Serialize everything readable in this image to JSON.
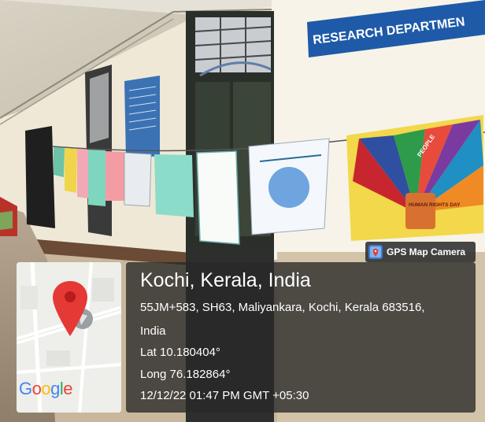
{
  "sign": {
    "text": "RESEARCH DEPARTMEN"
  },
  "badge": {
    "label": "GPS Map Camera",
    "icon": "gps-camera-icon"
  },
  "location": {
    "place": "Kochi, Kerala, India",
    "address_line1": "55JM+583, SH63, Maliyankara, Kochi, Kerala 683516,",
    "address_line2": "India",
    "lat": "Lat 10.180404°",
    "long": "Long 76.182864°",
    "datetime": "12/12/22 01:47 PM GMT +05:30"
  },
  "map": {
    "logo": {
      "G": "G",
      "o1": "o",
      "o2": "o",
      "g": "g",
      "l": "l",
      "e": "e"
    },
    "pin_icon": "map-pin-icon",
    "logo_colors": {
      "G": "#4285F4",
      "o1": "#EA4335",
      "o2": "#FBBC05",
      "g": "#4285F4",
      "l": "#34A853",
      "e": "#EA4335"
    }
  },
  "poster_text": {
    "p2": "PEOPLE",
    "p3": "HUMAN RIGHTS DAY"
  },
  "colors": {
    "wall": "#f4efdf",
    "floor_red": "#a52a20",
    "sign_blue": "#1e5aa8",
    "overlay": "#282828",
    "pin_red": "#e53935"
  }
}
